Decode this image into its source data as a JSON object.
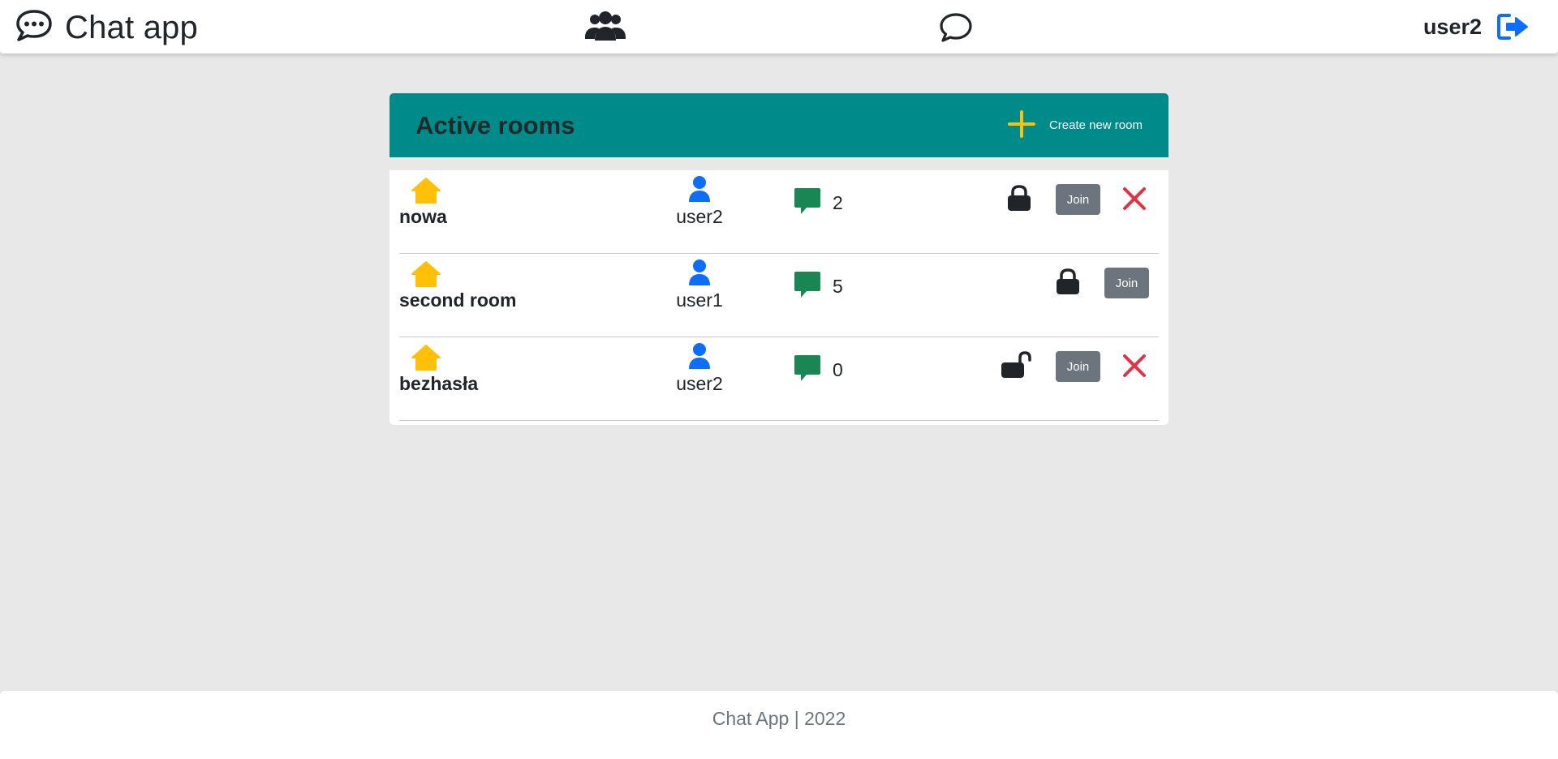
{
  "navbar": {
    "brand_title": "Chat app",
    "brand_icon": "chat-dots-icon",
    "users_icon": "people-fill-icon",
    "chat_icon": "chat-bubble-icon",
    "username": "user2",
    "logout_icon": "box-arrow-right-icon"
  },
  "rooms_panel": {
    "title": "Active rooms",
    "create_label": "Create new room",
    "header_color": "#008b8b",
    "rooms": [
      {
        "name": "nowa",
        "owner": "user2",
        "messages": "2",
        "locked": true,
        "join_label": "Join",
        "deletable": true
      },
      {
        "name": "second room",
        "owner": "user1",
        "messages": "5",
        "locked": true,
        "join_label": "Join",
        "deletable": false
      },
      {
        "name": "bezhasła",
        "owner": "user2",
        "messages": "0",
        "locked": false,
        "join_label": "Join",
        "deletable": true
      }
    ]
  },
  "colors": {
    "house": "#ffc107",
    "person": "#0d6efd",
    "message": "#198754",
    "delete": "#dc3545",
    "join": "#6c757d",
    "plus": "#ffc107"
  },
  "footer": {
    "text": "Chat App | 2022"
  }
}
